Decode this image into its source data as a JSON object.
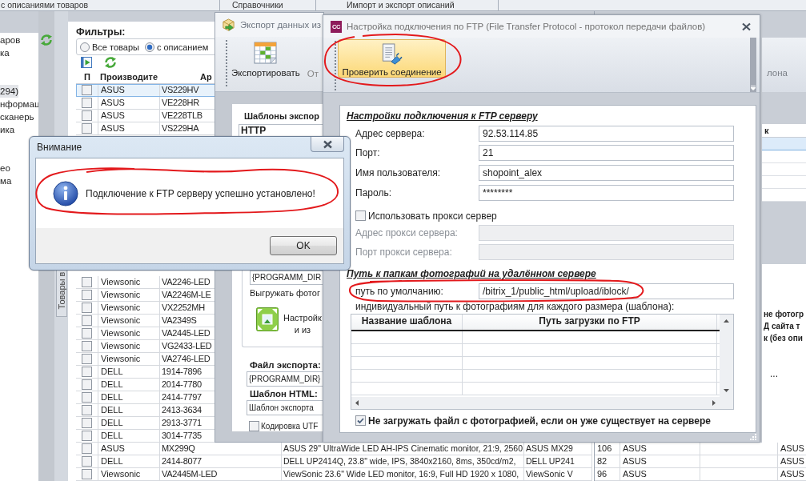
{
  "top_tabs": [
    "с описаниями товаров",
    "Справочники",
    "Импорт и экспорт описаний"
  ],
  "sidebar": {
    "groups": [
      [
        {
          "label": "аров",
          "selected": false
        },
        {
          "label": "ка",
          "selected": false
        }
      ],
      [
        {
          "label": "294)",
          "selected": true
        },
        {
          "label": "нформац",
          "selected": false
        },
        {
          "label": "сканерь",
          "selected": false
        },
        {
          "label": "ика",
          "selected": false
        }
      ],
      [
        {
          "label": "ео",
          "selected": false
        },
        {
          "label": "ма",
          "selected": false
        }
      ]
    ],
    "vertical_tab": "Товары в"
  },
  "products": {
    "filters_label": "Фильтры:",
    "filter_options": [
      {
        "label": "Все товары",
        "selected": false
      },
      {
        "label": "с описанием",
        "selected": true
      }
    ],
    "columns": [
      "П",
      "Производите",
      "Ар"
    ],
    "rows_top": [
      {
        "checked": false,
        "selected": true,
        "maker": "ASUS",
        "article": "VS229HV"
      },
      {
        "checked": false,
        "selected": false,
        "maker": "ASUS",
        "article": "VE228HR"
      },
      {
        "checked": false,
        "selected": false,
        "maker": "ASUS",
        "article": "VE228TLB"
      },
      {
        "checked": false,
        "selected": false,
        "maker": "ASUS",
        "article": "VS229HA"
      }
    ],
    "rows_bottom": [
      {
        "checked": false,
        "selected": false,
        "maker": "Viewsonic",
        "article": "VA2246-LED"
      },
      {
        "checked": false,
        "selected": false,
        "maker": "Viewsonic",
        "article": "VA2246M-LE"
      },
      {
        "checked": false,
        "selected": false,
        "maker": "Viewsonic",
        "article": "VX2252MH"
      },
      {
        "checked": false,
        "selected": false,
        "maker": "Viewsonic",
        "article": "VA2349S"
      },
      {
        "checked": false,
        "selected": false,
        "maker": "Viewsonic",
        "article": "VA2445-LED"
      },
      {
        "checked": false,
        "selected": false,
        "maker": "Viewsonic",
        "article": "VG2433-LED"
      },
      {
        "checked": false,
        "selected": false,
        "maker": "Viewsonic",
        "article": "VA2746-LED"
      },
      {
        "checked": false,
        "selected": false,
        "maker": "DELL",
        "article": "1914-7896"
      },
      {
        "checked": false,
        "selected": false,
        "maker": "DELL",
        "article": "2014-7780"
      },
      {
        "checked": false,
        "selected": false,
        "maker": "DELL",
        "article": "2414-7797"
      },
      {
        "checked": false,
        "selected": false,
        "maker": "DELL",
        "article": "2413-3634"
      },
      {
        "checked": false,
        "selected": false,
        "maker": "DELL",
        "article": "2913-3771"
      },
      {
        "checked": false,
        "selected": false,
        "maker": "DELL",
        "article": "3014-7735"
      },
      {
        "checked": false,
        "selected": false,
        "maker": "ASUS",
        "article": "MX299Q",
        "description": "ASUS 29\" UltraWide LED AH-IPS Cinematic monitor, 21:9, 2560",
        "column_5": "ASUS MX29"
      },
      {
        "checked": false,
        "selected": false,
        "maker": "DELL",
        "article": "2414-8077",
        "description": "DELL UP2414Q, 23.8\" wide, IPS, 3840x2160, 8ms, 350cd/m2,",
        "column_5": "DELL UP241"
      },
      {
        "checked": false,
        "selected": false,
        "maker": "Viewsonic",
        "article": "VA2445M-LED",
        "description": "ViewSonic 23.6\" Wide LED monitor, 16:9, Full HD 1920 x 1080,",
        "column_5": "ViewSonic V"
      }
    ]
  },
  "right_pane": {
    "toolbar_label": "лона",
    "column_header": "к",
    "grid_rows": [
      {
        "selected": true
      },
      {
        "selected": false
      },
      {
        "selected": false
      },
      {
        "selected": false
      },
      {
        "selected": false
      }
    ],
    "notes": [
      "не фотогр",
      "Д сайта т",
      "к (без опи"
    ],
    "ellipsis": "...",
    "rows": [
      {
        "column_1": "106",
        "column_2": "ASUS",
        "column_4": "ASUS"
      },
      {
        "column_1": "82",
        "column_2": "ASUS",
        "column_4": "ASUS"
      },
      {
        "column_1": "96",
        "column_2": "ASUS",
        "column_4": "ASUS"
      }
    ]
  },
  "export_window": {
    "title": "Экспорт данных из",
    "export_button": "Экспортировать",
    "next_button": "От",
    "templates_heading": "Шаблоны экспор",
    "templates_column": "HTTP",
    "path_value": "{PROGRAMM_DIR",
    "photos_label": "Выгружать фотог",
    "photo_settings": [
      "Настройк",
      "и из"
    ],
    "file_label": "Файл экспорта:",
    "file_value": "{PROGRAMM_DIR}",
    "html_label": "Шаблон HTML:",
    "html_value": "Шаблон экспорта",
    "utf_checkbox": {
      "label": "Кодировка UTF",
      "checked": false
    }
  },
  "alert": {
    "title": "Внимание",
    "message": "Подключение к FTP серверу успешно установлено!",
    "ok_button": "OK"
  },
  "ftp_dialog": {
    "badge": "CC",
    "title": "Настройка подключения по FTP (File Transfer Protocol - протокол передачи файлов)",
    "check_button": {
      "label": "Проверить соединение",
      "highlighted": true
    },
    "connection_heading": "Настройки подключения к FTP серверу",
    "fields": [
      {
        "label": "Адрес сервера:",
        "value": "92.53.114.85",
        "disabled": false
      },
      {
        "label": "Порт:",
        "value": "21",
        "disabled": false
      },
      {
        "label": "Имя пользователя:",
        "value": "shopoint_alex",
        "disabled": false
      },
      {
        "label": "Пароль:",
        "value": "********",
        "disabled": false
      }
    ],
    "proxy_checkbox": {
      "label": "Использовать прокси сервер",
      "checked": false
    },
    "proxy_fields": [
      {
        "label": "Адрес прокси сервера:",
        "disabled": true
      },
      {
        "label": "Порт прокси сервера:",
        "disabled": true
      }
    ],
    "paths_heading": "Путь к папкам фотографий на удалённом сервере",
    "default_path": {
      "label": "путь по умолчанию:",
      "value": "/bitrix_1/public_html/upload/iblock/"
    },
    "individual_note": "индивидуальный путь к фотографиям для каждого размера (шаблона):",
    "grid_columns": [
      "Название шаблона",
      "Путь загрузки по FTP"
    ],
    "skip_existing": {
      "label": "Не загружать файл с фотографией, если он уже существует на сервере",
      "checked": true
    }
  }
}
